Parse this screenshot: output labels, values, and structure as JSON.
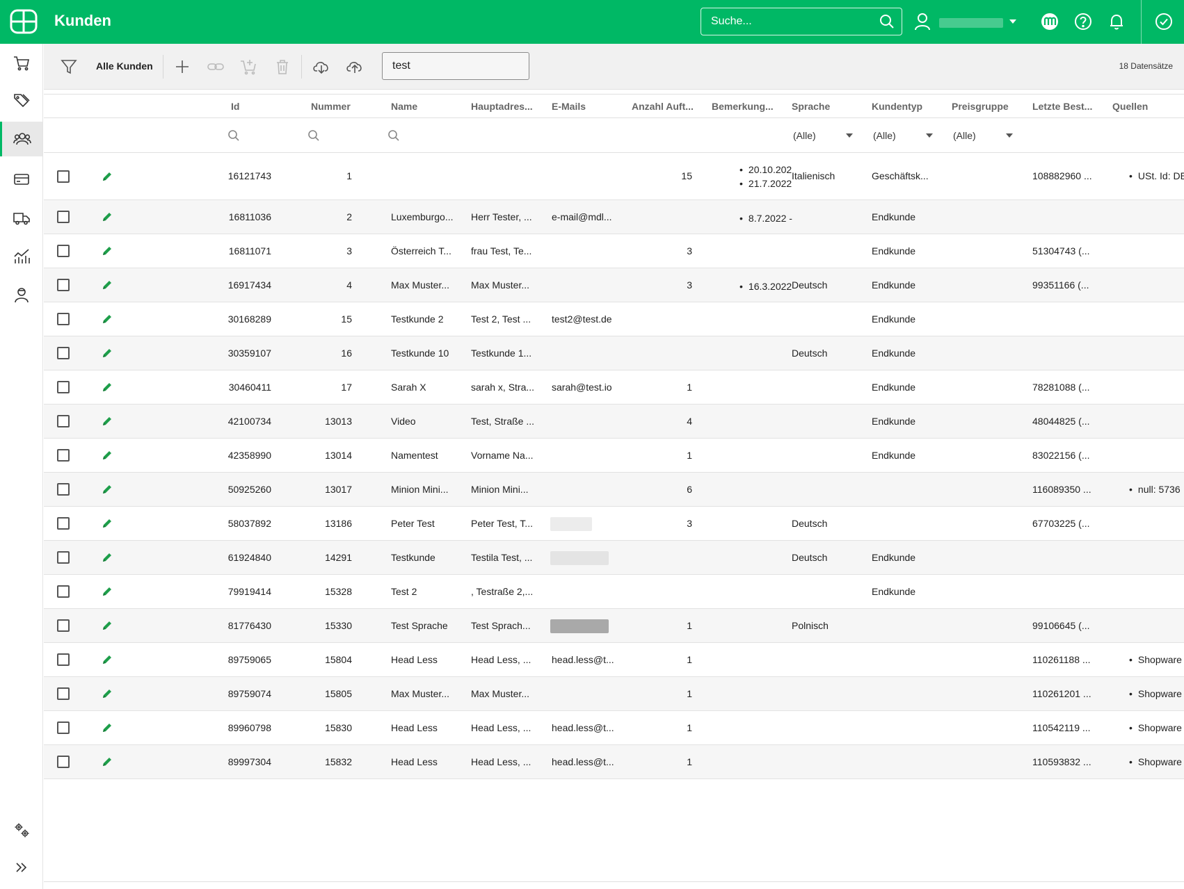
{
  "header": {
    "title": "Kunden",
    "search_placeholder": "Suche...",
    "icons": [
      "logo-icon",
      "search-icon",
      "user-icon",
      "chevron-down-icon",
      "marketplace-icon",
      "help-icon",
      "bell-icon",
      "check-circle-icon"
    ]
  },
  "sidebar": {
    "items": [
      {
        "icon": "cart-icon"
      },
      {
        "icon": "tags-icon"
      },
      {
        "icon": "customers-icon",
        "active": true
      },
      {
        "icon": "card-icon"
      },
      {
        "icon": "truck-icon"
      },
      {
        "icon": "chart-icon"
      },
      {
        "icon": "person-icon"
      }
    ],
    "bottom": [
      {
        "icon": "settings-icon"
      },
      {
        "icon": "expand-icon"
      }
    ]
  },
  "toolbar": {
    "filter_label": "Alle Kunden",
    "filter_value": "test",
    "record_count": "18 Datensätze"
  },
  "table": {
    "columns": [
      "Id",
      "Nummer",
      "Name",
      "Hauptadres...",
      "E-Mails",
      "Anzahl Auft...",
      "Bemerkung...",
      "Sprache",
      "Kundentyp",
      "Preisgruppe",
      "Letzte Best...",
      "Quellen"
    ],
    "filters": {
      "sprache": "(Alle)",
      "kundentyp": "(Alle)",
      "preisgruppe": "(Alle)"
    },
    "rows": [
      {
        "id": "16121743",
        "nummer": "1",
        "name": "",
        "adresse": "",
        "email": "",
        "auftraege": "15",
        "bemerkung": [
          "20.10.202",
          "21.7.2022"
        ],
        "sprache": "Italienisch",
        "kundentyp": "Geschäftsk...",
        "preisgruppe": "",
        "letzte": "108882960 ...",
        "quellen": "USt. Id: DE"
      },
      {
        "id": "16811036",
        "nummer": "2",
        "name": "Luxemburgo...",
        "adresse": "Herr Tester, ...",
        "email": "e-mail@mdl...",
        "auftraege": "",
        "bemerkung": [
          "8.7.2022 -"
        ],
        "sprache": "",
        "kundentyp": "Endkunde",
        "preisgruppe": "",
        "letzte": "",
        "quellen": ""
      },
      {
        "id": "16811071",
        "nummer": "3",
        "name": "Österreich T...",
        "adresse": "frau Test, Te...",
        "email": "",
        "auftraege": "3",
        "bemerkung": [],
        "sprache": "",
        "kundentyp": "Endkunde",
        "preisgruppe": "",
        "letzte": "51304743 (...",
        "quellen": ""
      },
      {
        "id": "16917434",
        "nummer": "4",
        "name": "Max Muster...",
        "adresse": "Max Muster...",
        "email": "",
        "auftraege": "3",
        "bemerkung": [
          "16.3.2022"
        ],
        "sprache": "Deutsch",
        "kundentyp": "Endkunde",
        "preisgruppe": "",
        "letzte": "99351166 (...",
        "quellen": ""
      },
      {
        "id": "30168289",
        "nummer": "15",
        "name": "Testkunde 2",
        "adresse": "Test 2, Test ...",
        "email": "test2@test.de",
        "auftraege": "",
        "bemerkung": [],
        "sprache": "",
        "kundentyp": "Endkunde",
        "preisgruppe": "",
        "letzte": "",
        "quellen": ""
      },
      {
        "id": "30359107",
        "nummer": "16",
        "name": "Testkunde 10",
        "adresse": "Testkunde 1...",
        "email": "",
        "auftraege": "",
        "bemerkung": [],
        "sprache": "Deutsch",
        "kundentyp": "Endkunde",
        "preisgruppe": "",
        "letzte": "",
        "quellen": ""
      },
      {
        "id": "30460411",
        "nummer": "17",
        "name": "Sarah X",
        "adresse": "sarah x, Stra...",
        "email": "sarah@test.io",
        "auftraege": "1",
        "bemerkung": [],
        "sprache": "",
        "kundentyp": "Endkunde",
        "preisgruppe": "",
        "letzte": "78281088 (...",
        "quellen": ""
      },
      {
        "id": "42100734",
        "nummer": "13013",
        "name": "Video",
        "adresse": "Test, Straße ...",
        "email": "",
        "auftraege": "4",
        "bemerkung": [],
        "sprache": "",
        "kundentyp": "Endkunde",
        "preisgruppe": "",
        "letzte": "48044825 (...",
        "quellen": ""
      },
      {
        "id": "42358990",
        "nummer": "13014",
        "name": "Namentest",
        "adresse": "Vorname Na...",
        "email": "",
        "auftraege": "1",
        "bemerkung": [],
        "sprache": "",
        "kundentyp": "Endkunde",
        "preisgruppe": "",
        "letzte": "83022156 (...",
        "quellen": ""
      },
      {
        "id": "50925260",
        "nummer": "13017",
        "name": "Minion Mini...",
        "adresse": "Minion Mini...",
        "email": "",
        "auftraege": "6",
        "bemerkung": [],
        "sprache": "",
        "kundentyp": "",
        "preisgruppe": "",
        "letzte": "116089350 ...",
        "quellen": "null: 5736"
      },
      {
        "id": "58037892",
        "nummer": "13186",
        "name": "Peter Test",
        "adresse": "Peter Test, T...",
        "email": "",
        "auftraege": "3",
        "bemerkung": [],
        "sprache": "Deutsch",
        "kundentyp": "",
        "preisgruppe": "",
        "letzte": "67703225 (...",
        "quellen": ""
      },
      {
        "id": "61924840",
        "nummer": "14291",
        "name": "Testkunde",
        "adresse": "Testila Test, ...",
        "email": "",
        "auftraege": "",
        "bemerkung": [],
        "sprache": "Deutsch",
        "kundentyp": "Endkunde",
        "preisgruppe": "",
        "letzte": "",
        "quellen": ""
      },
      {
        "id": "79919414",
        "nummer": "15328",
        "name": "Test 2",
        "adresse": ", Testraße 2,...",
        "email": "",
        "auftraege": "",
        "bemerkung": [],
        "sprache": "",
        "kundentyp": "Endkunde",
        "preisgruppe": "",
        "letzte": "",
        "quellen": ""
      },
      {
        "id": "81776430",
        "nummer": "15330",
        "name": "Test Sprache",
        "adresse": "Test Sprach...",
        "email": "",
        "auftraege": "1",
        "bemerkung": [],
        "sprache": "Polnisch",
        "kundentyp": "",
        "preisgruppe": "",
        "letzte": "99106645 (...",
        "quellen": ""
      },
      {
        "id": "89759065",
        "nummer": "15804",
        "name": "Head Less",
        "adresse": "Head Less, ...",
        "email": "head.less@t...",
        "auftraege": "1",
        "bemerkung": [],
        "sprache": "",
        "kundentyp": "",
        "preisgruppe": "",
        "letzte": "110261188 ...",
        "quellen": "Shopware"
      },
      {
        "id": "89759074",
        "nummer": "15805",
        "name": "Max Muster...",
        "adresse": "Max Muster...",
        "email": "",
        "auftraege": "1",
        "bemerkung": [],
        "sprache": "",
        "kundentyp": "",
        "preisgruppe": "",
        "letzte": "110261201 ...",
        "quellen": "Shopware"
      },
      {
        "id": "89960798",
        "nummer": "15830",
        "name": "Head Less",
        "adresse": "Head Less, ...",
        "email": "head.less@t...",
        "auftraege": "1",
        "bemerkung": [],
        "sprache": "",
        "kundentyp": "",
        "preisgruppe": "",
        "letzte": "110542119 ...",
        "quellen": "Shopware"
      },
      {
        "id": "89997304",
        "nummer": "15832",
        "name": "Head Less",
        "adresse": "Head Less, ...",
        "email": "head.less@t...",
        "auftraege": "1",
        "bemerkung": [],
        "sprache": "",
        "kundentyp": "",
        "preisgruppe": "",
        "letzte": "110593832 ...",
        "quellen": "Shopware"
      }
    ]
  },
  "colors": {
    "brand": "#00b865",
    "edit_icon": "#1e9e4a"
  }
}
